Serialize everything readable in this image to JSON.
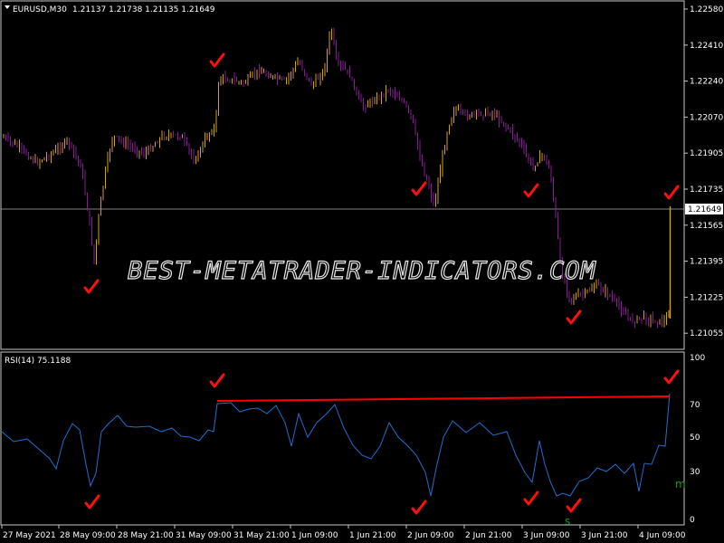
{
  "main_chart": {
    "title": "EURUSD,M30",
    "ohlc": "1.21137 1.21738 1.21135 1.21649",
    "current_price_label": "1.21649",
    "price_levels": [
      "1.22580",
      "1.22410",
      "1.22240",
      "1.22070",
      "1.21905",
      "1.21735",
      "1.21565",
      "1.21395",
      "1.21225",
      "1.21055"
    ],
    "bull_color": "#d4a017",
    "bear_color": "#8a1a9a"
  },
  "rsi_panel": {
    "title": "RSI(14) 75.1188",
    "levels": [
      "100",
      "70",
      "50",
      "30",
      "0"
    ],
    "line_color": "#1f6fd0",
    "trend_color": "#ff0000",
    "marker_m": "m",
    "marker_s": "s"
  },
  "time_axis": {
    "labels": [
      "27 May 2021",
      "28 May 09:00",
      "28 May 21:00",
      "31 May 09:00",
      "31 May 21:00",
      "1 Jun 09:00",
      "1 Jun 21:00",
      "2 Jun 09:00",
      "2 Jun 21:00",
      "3 Jun 09:00",
      "3 Jun 21:00",
      "4 Jun 09:00"
    ]
  },
  "watermark": {
    "text": "BEST-METATRADER-INDICATORS.COM"
  },
  "chart_data": {
    "type": "line",
    "title": "EURUSD,M30",
    "xlabel": "",
    "ylabel": "",
    "ylim": [
      1.2098,
      1.2262
    ],
    "x": [
      "27 May 2021",
      "28 May 09:00",
      "28 May 21:00",
      "31 May 09:00",
      "31 May 21:00",
      "1 Jun 09:00",
      "1 Jun 21:00",
      "2 Jun 09:00",
      "2 Jun 21:00",
      "3 Jun 09:00",
      "3 Jun 21:00",
      "4 Jun 09:00"
    ],
    "series": [
      {
        "values": [
          1.22,
          1.2135,
          1.2205,
          1.2225,
          1.2228,
          1.2245,
          1.2215,
          1.2175,
          1.2205,
          1.219,
          1.212,
          1.211
        ]
      }
    ],
    "grid": false
  }
}
